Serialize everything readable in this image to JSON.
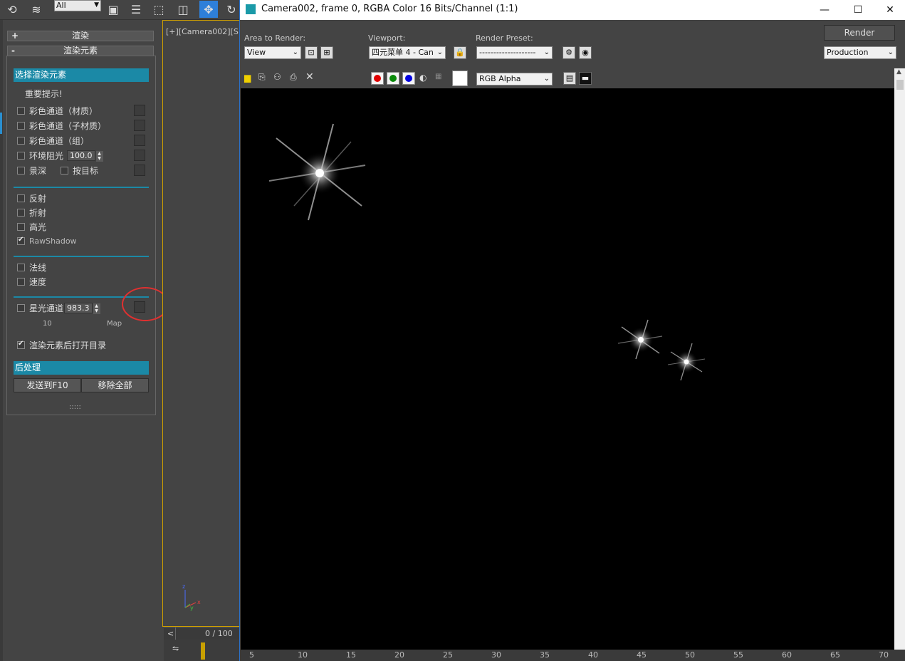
{
  "toolbar": {
    "selection_filter": "All"
  },
  "command_panel": {
    "rollout_render": {
      "sign": "+",
      "label": "渲染"
    },
    "rollout_elements": {
      "sign": "-",
      "label": "渲染元素"
    },
    "section_select": "选择渲染元素",
    "notice": "重要提示!",
    "group1": [
      {
        "label": "彩色通道（材质）",
        "checked": false
      },
      {
        "label": "彩色通道（子材质）",
        "checked": false
      },
      {
        "label": "彩色通道（组）",
        "checked": false
      }
    ],
    "ao": {
      "label": "环境阻光",
      "value": "100.0"
    },
    "dof": {
      "label": "景深",
      "target_label": "按目标"
    },
    "group2": [
      {
        "label": "反射",
        "checked": false
      },
      {
        "label": "折射",
        "checked": false
      },
      {
        "label": "高光",
        "checked": false
      },
      {
        "label": "RawShadow",
        "checked": true
      }
    ],
    "group3": [
      {
        "label": "法线",
        "checked": false
      },
      {
        "label": "速度",
        "checked": false
      }
    ],
    "starlight": {
      "label": "星光通道",
      "value": "983.3",
      "sub_left": "10",
      "sub_right": "Map"
    },
    "open_after": {
      "label": "渲染元素后打开目录",
      "checked": true
    },
    "section_post": "后处理",
    "send_button": "发送到F10",
    "remove_button": "移除全部",
    "grip": ":::::"
  },
  "viewport": {
    "label": "[+][Camera002][S",
    "timeline_prev": "<",
    "timeline_value": "0 / 100"
  },
  "render_window": {
    "title": "Camera002, frame 0, RGBA Color 16 Bits/Channel (1:1)",
    "minimize": "—",
    "maximize": "☐",
    "close": "✕",
    "area_label": "Area to Render:",
    "area_value": "View",
    "viewport_label": "Viewport:",
    "viewport_value": "四元菜单 4 - Can",
    "preset_label": "Render Preset:",
    "preset_value": "--------------------",
    "render_button": "Render",
    "production_value": "Production",
    "channel_display": "RGB Alpha",
    "ruler_ticks": [
      "5",
      "10",
      "15",
      "20",
      "25",
      "30",
      "35",
      "40",
      "45",
      "50",
      "55",
      "60",
      "65",
      "70"
    ]
  },
  "colors": {
    "accent": "#1b89a6",
    "highlight_circle": "#e03030",
    "red_channel": "#e00000",
    "green_channel": "#0a8a0a",
    "blue_channel": "#0000e0"
  }
}
